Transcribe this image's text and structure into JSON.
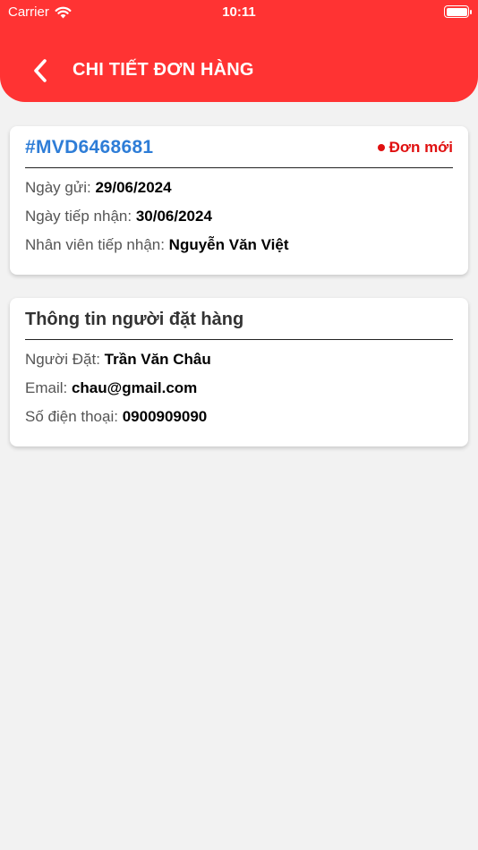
{
  "status_bar": {
    "carrier": "Carrier",
    "time": "10:11"
  },
  "header": {
    "title": "CHI TIẾT ĐƠN HÀNG",
    "background_color": "#ff3333",
    "back_icon": "chevron-left-icon"
  },
  "order": {
    "code": "#MVD6468681",
    "status": "Đơn mới",
    "status_color": "#e01010",
    "rows": [
      {
        "label": "Ngày gửi: ",
        "value": "29/06/2024"
      },
      {
        "label": "Ngày tiếp nhận: ",
        "value": "30/06/2024"
      },
      {
        "label": "Nhân viên tiếp nhận: ",
        "value": "Nguyễn Văn Việt"
      }
    ]
  },
  "customer": {
    "title": "Thông tin người đặt hàng",
    "rows": [
      {
        "label": "Người Đặt: ",
        "value": "Trần Văn Châu"
      },
      {
        "label": "Email: ",
        "value": "chau@gmail.com"
      },
      {
        "label": "Số điện thoại: ",
        "value": "0900909090"
      }
    ]
  }
}
